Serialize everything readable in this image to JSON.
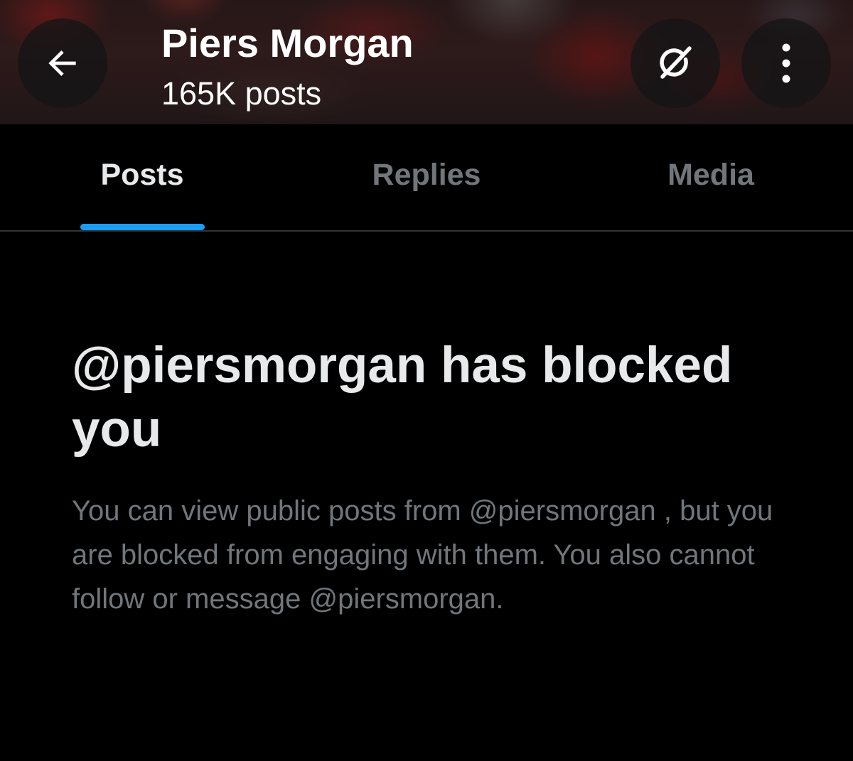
{
  "header": {
    "back_icon": "arrow-left-icon",
    "name": "Piers Morgan",
    "post_count": "165K posts",
    "grok_icon": "grok-icon",
    "more_icon": "more-vertical-icon"
  },
  "tabs": [
    {
      "label": "Posts",
      "active": true
    },
    {
      "label": "Replies",
      "active": false
    },
    {
      "label": "Media",
      "active": false
    }
  ],
  "blocked": {
    "heading": "@piersmorgan has blocked you",
    "body": "You can view public posts from @piersmorgan , but you are blocked from engaging with them. You also cannot follow or message @piersmorgan."
  },
  "colors": {
    "background": "#000000",
    "primary_text": "#e7e9ea",
    "secondary_text": "#71767b",
    "accent": "#1d9bf0",
    "divider": "#2f3336"
  }
}
